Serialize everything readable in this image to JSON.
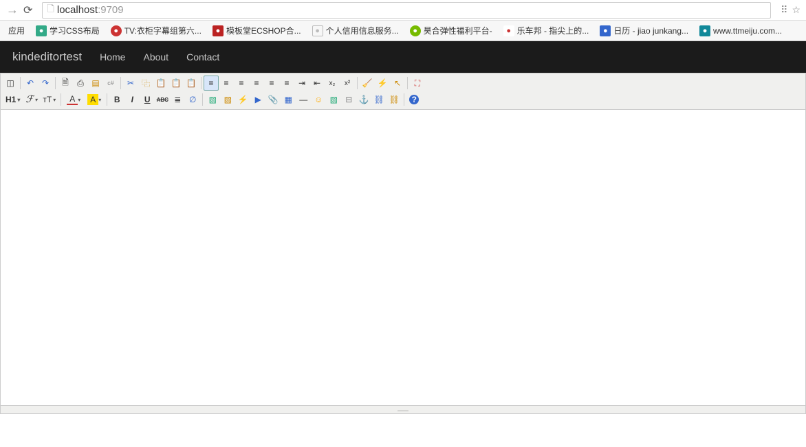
{
  "browser": {
    "url_host": "localhost",
    "url_port": ":9709"
  },
  "bookmarks": [
    {
      "label": "应用",
      "favClass": ""
    },
    {
      "label": "学习CSS布局",
      "favClass": "f-green"
    },
    {
      "label": "TV:衣柜字幕组第六...",
      "favClass": "f-red"
    },
    {
      "label": "模板堂ECSHOP合...",
      "favClass": "f-redbox"
    },
    {
      "label": "个人信用信息服务...",
      "favClass": "f-page"
    },
    {
      "label": "昊合弹性福利平台-",
      "favClass": "f-lime"
    },
    {
      "label": "乐车邦 - 指尖上的...",
      "favClass": "f-leche"
    },
    {
      "label": "日历 - jiao junkang...",
      "favClass": "f-blue"
    },
    {
      "label": "www.ttmeiju.com...",
      "favClass": "f-teal"
    }
  ],
  "navbar": {
    "brand": "kindeditortest",
    "links": [
      "Home",
      "About",
      "Contact"
    ]
  },
  "editor": {
    "format_label": "H1",
    "font_family_label": "ℱ",
    "font_size_label": "ᴛT",
    "row1": [
      {
        "name": "source",
        "glyph": "◫",
        "title": "Source"
      },
      {
        "sep": true
      },
      {
        "name": "undo",
        "glyph": "↶",
        "title": "Undo",
        "color": "#36c"
      },
      {
        "name": "redo",
        "glyph": "↷",
        "title": "Redo",
        "color": "#36c"
      },
      {
        "sep": true
      },
      {
        "name": "preview",
        "glyph": "🗎",
        "title": "Preview"
      },
      {
        "name": "print",
        "glyph": "⎙",
        "title": "Print"
      },
      {
        "name": "template",
        "glyph": "▤",
        "title": "Template",
        "color": "#c80"
      },
      {
        "name": "code",
        "glyph": "c#",
        "title": "Code",
        "color": "#888",
        "size": "9px"
      },
      {
        "sep": true
      },
      {
        "name": "cut",
        "glyph": "✂",
        "title": "Cut",
        "color": "#36c"
      },
      {
        "name": "copy",
        "glyph": "⿻",
        "title": "Copy",
        "color": "#c80"
      },
      {
        "name": "paste",
        "glyph": "📋",
        "title": "Paste"
      },
      {
        "name": "paste-text",
        "glyph": "📋",
        "title": "Paste Text"
      },
      {
        "name": "paste-word",
        "glyph": "📋",
        "title": "Paste Word"
      },
      {
        "sep": true
      },
      {
        "name": "align-left",
        "glyph": "≡",
        "title": "Align Left",
        "active": true
      },
      {
        "name": "align-center",
        "glyph": "≡",
        "title": "Align Center"
      },
      {
        "name": "align-right",
        "glyph": "≡",
        "title": "Align Right"
      },
      {
        "name": "align-justify",
        "glyph": "≡",
        "title": "Justify"
      },
      {
        "name": "ordered-list",
        "glyph": "≡",
        "title": "Ordered List"
      },
      {
        "name": "unordered-list",
        "glyph": "≡",
        "title": "Unordered List"
      },
      {
        "name": "indent",
        "glyph": "⇥",
        "title": "Indent"
      },
      {
        "name": "outdent",
        "glyph": "⇤",
        "title": "Outdent"
      },
      {
        "name": "subscript",
        "glyph": "x₂",
        "title": "Subscript",
        "size": "10px"
      },
      {
        "name": "superscript",
        "glyph": "x²",
        "title": "Superscript",
        "size": "10px"
      },
      {
        "sep": true
      },
      {
        "name": "clear-format",
        "glyph": "🧹",
        "title": "Clear Format",
        "color": "#c80"
      },
      {
        "name": "quick-format",
        "glyph": "⚡",
        "title": "Quick Format",
        "color": "#c80"
      },
      {
        "name": "select-all",
        "glyph": "↖",
        "title": "Select All",
        "color": "#c80"
      },
      {
        "sep": true
      },
      {
        "name": "fullscreen",
        "glyph": "⛶",
        "title": "Fullscreen",
        "color": "#c33"
      }
    ],
    "row2": [
      {
        "format": true
      },
      {
        "fontfamily": true
      },
      {
        "fontsize": true
      },
      {
        "sep": true
      },
      {
        "name": "forecolor",
        "glyph": "A",
        "title": "Text Color",
        "underline": "#c33",
        "drop": true
      },
      {
        "name": "backcolor",
        "glyph": "A",
        "title": "Background",
        "bg": "#fd0",
        "drop": true
      },
      {
        "sep": true
      },
      {
        "name": "bold",
        "glyph": "B",
        "title": "Bold",
        "weight": "bold"
      },
      {
        "name": "italic",
        "glyph": "I",
        "title": "Italic",
        "style": "italic",
        "weight": "bold"
      },
      {
        "name": "underline",
        "glyph": "U",
        "title": "Underline",
        "decoration": "underline",
        "weight": "bold"
      },
      {
        "name": "strike",
        "glyph": "ABC",
        "title": "Strikethrough",
        "decoration": "line-through",
        "size": "8px",
        "weight": "bold"
      },
      {
        "name": "line-height",
        "glyph": "≣",
        "title": "Line Height"
      },
      {
        "name": "remove-format",
        "glyph": "∅",
        "title": "Remove Format",
        "color": "#36c"
      },
      {
        "sep": true
      },
      {
        "name": "image",
        "glyph": "▧",
        "title": "Image",
        "color": "#2a7"
      },
      {
        "name": "multi-image",
        "glyph": "▧",
        "title": "Multi Image",
        "color": "#c80"
      },
      {
        "name": "flash",
        "glyph": "⚡",
        "title": "Flash",
        "color": "#c33"
      },
      {
        "name": "media",
        "glyph": "▶",
        "title": "Media",
        "color": "#36c"
      },
      {
        "name": "file",
        "glyph": "📎",
        "title": "File",
        "color": "#888"
      },
      {
        "name": "table",
        "glyph": "▦",
        "title": "Table",
        "color": "#36c"
      },
      {
        "name": "hr",
        "glyph": "—",
        "title": "HR"
      },
      {
        "name": "emoji",
        "glyph": "☺",
        "title": "Emoji",
        "color": "#fa0"
      },
      {
        "name": "baidu-map",
        "glyph": "▧",
        "title": "Map",
        "color": "#2a7"
      },
      {
        "name": "pagebreak",
        "glyph": "⊟",
        "title": "Page Break",
        "color": "#888"
      },
      {
        "name": "anchor",
        "glyph": "⚓",
        "title": "Anchor",
        "color": "#888"
      },
      {
        "name": "link",
        "glyph": "⛓",
        "title": "Link",
        "color": "#36c"
      },
      {
        "name": "unlink",
        "glyph": "⛓",
        "title": "Unlink",
        "color": "#c80"
      },
      {
        "sep": true
      },
      {
        "name": "about",
        "glyph": "?",
        "title": "About",
        "color": "#fff",
        "bg": "#36c",
        "round": true
      }
    ]
  }
}
